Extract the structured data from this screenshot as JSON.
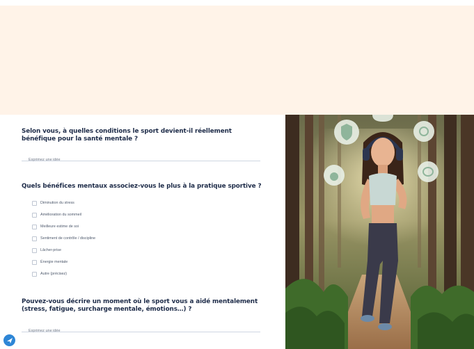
{
  "theme": {
    "banner_color": "#fff3e8",
    "question_color": "#1d2b48",
    "accent": "#2e86d6"
  },
  "form": {
    "q1": {
      "title": "Selon vous, à quelles conditions le sport devient-il réellement bénéfique pour la santé mentale ?",
      "placeholder": "Exprimez une idée"
    },
    "q2": {
      "title": "Quels bénéfices mentaux associez-vous le plus à la pratique sportive ?",
      "options": [
        "Diminution du stress",
        "Amélioration du sommeil",
        "Meilleure estime de soi",
        "Sentiment de contrôle / discipline",
        "Lâcher-prise",
        "Énergie mentale",
        "Autre (précisez)"
      ]
    },
    "q3": {
      "title": "Pouvez-vous décrire un moment où le sport vous a aidé mentalement (stress, fatigue, surcharge mentale, émotions…) ?",
      "placeholder": "Exprimez une idée"
    }
  },
  "illustration": {
    "bubbles": [
      "shield-icon",
      "flower-icon",
      "apple-icon",
      "brain-icon"
    ]
  },
  "fab": {
    "icon": "send-icon"
  }
}
